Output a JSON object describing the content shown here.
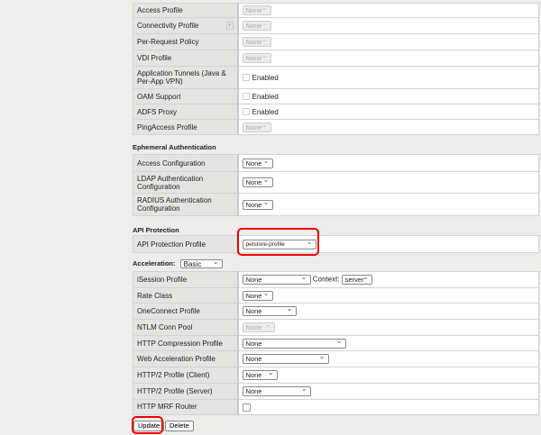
{
  "profiles": {
    "rows": [
      {
        "label": "Access Profile",
        "type": "select",
        "value": "None",
        "disabled": true
      },
      {
        "label": "Connectivity Profile",
        "type": "select",
        "value": "None",
        "disabled": true,
        "plus": "+"
      },
      {
        "label": "Per-Request Policy",
        "type": "select",
        "value": "None",
        "disabled": true
      },
      {
        "label": "VDI Profile",
        "type": "select",
        "value": "None",
        "disabled": true
      },
      {
        "label": "Application Tunnels (Java & Per-App VPN)",
        "type": "check",
        "value": "Enabled",
        "disabled": true
      },
      {
        "label": "OAM Support",
        "type": "check",
        "value": "Enabled",
        "disabled": true
      },
      {
        "label": "ADFS Proxy",
        "type": "check",
        "value": "Enabled",
        "disabled": true
      },
      {
        "label": "PingAccess Profile",
        "type": "select",
        "value": "None",
        "disabled": true
      }
    ]
  },
  "ephemeral": {
    "title": "Ephemeral Authentication",
    "rows": [
      {
        "label": "Access Configuration",
        "value": "None"
      },
      {
        "label": "LDAP Authentication Configuration",
        "value": "None"
      },
      {
        "label": "RADIUS Authentication Configuration",
        "value": "None"
      }
    ]
  },
  "api": {
    "title": "API Protection",
    "label": "API Protection Profile",
    "value": "petstore-profile"
  },
  "acceleration": {
    "title": "Acceleration:",
    "mode": "Basic",
    "context_label": "Context:",
    "context_value": "server",
    "rows": [
      {
        "label": "iSession Profile",
        "value": "None",
        "w": 76
      },
      {
        "label": "Rate Class",
        "value": "None",
        "w": 34
      },
      {
        "label": "OneConnect Profile",
        "value": "None",
        "w": 60
      },
      {
        "label": "NTLM Conn Pool",
        "value": "None",
        "w": 36,
        "disabled": true
      },
      {
        "label": "HTTP Compression Profile",
        "value": "None",
        "w": 115
      },
      {
        "label": "Web Acceleration Profile",
        "value": "None",
        "w": 96
      },
      {
        "label": "HTTP/2 Profile (Client)",
        "value": "None",
        "w": 39
      },
      {
        "label": "HTTP/2 Profile (Server)",
        "value": "None",
        "w": 76
      },
      {
        "label": "HTTP MRF Router",
        "type": "check"
      }
    ]
  },
  "buttons": {
    "update": "Update",
    "delete": "Delete"
  },
  "colors": {
    "highlight": "#e00000"
  }
}
